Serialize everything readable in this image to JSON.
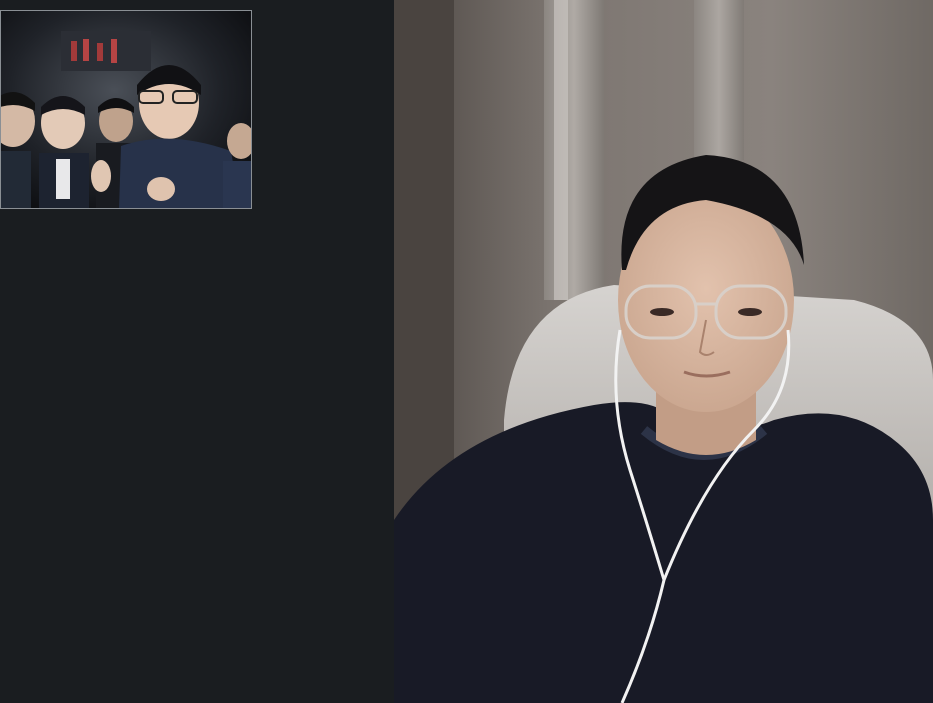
{
  "call": {
    "self_view": {
      "description_icon": "group-photo-video-tile",
      "participants_visible": 4
    },
    "remote_participant": {
      "icon": "person-video-feed"
    }
  },
  "colors": {
    "background": "#1a1d20",
    "tile_border": "#8a8f94",
    "wall": "#6d6763",
    "sweater": "#181a26"
  }
}
